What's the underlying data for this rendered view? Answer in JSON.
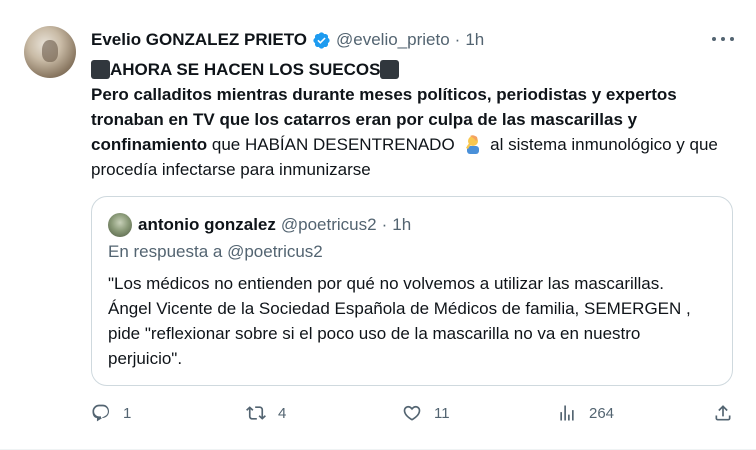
{
  "tweet": {
    "author_name": "Evelio GONZALEZ PRIETO",
    "handle": "@evelio_prieto",
    "separator": "·",
    "time": "1h",
    "headline": "AHORA SE HACEN LOS SUECOS",
    "body_bold": "Pero calladitos mientras durante meses  políticos, periodistas y expertos tronaban en TV que los catarros eran por culpa de las mascarillas y confinamiento",
    "body_regular_1": " que HABÍAN DESENTRENADO",
    "body_regular_2": " al sistema inmunológico y que procedía infectarse para inmunizarse"
  },
  "quote": {
    "author_name": "antonio gonzalez",
    "handle": "@poetricus2",
    "separator": "·",
    "time": "1h",
    "reply_to": "En respuesta a @poetricus2",
    "text": "\"Los médicos no entienden por qué no volvemos a utilizar las mascarillas. Ángel Vicente de la Sociedad Española de Médicos de familia, SEMERGEN , pide \"reflexionar sobre si el poco uso de la mascarilla no va en nuestro perjuicio\"."
  },
  "actions": {
    "replies": "1",
    "retweets": "4",
    "likes": "11",
    "views": "264"
  },
  "colors": {
    "verified": "#1d9bf0",
    "secondary_text": "#536471",
    "border": "#cfd9de"
  },
  "icons": [
    "verified-badge-icon",
    "more-icon",
    "reply-icon",
    "retweet-icon",
    "like-icon",
    "views-icon",
    "share-icon",
    "black-square-icon",
    "facepalm-emoji-icon"
  ]
}
